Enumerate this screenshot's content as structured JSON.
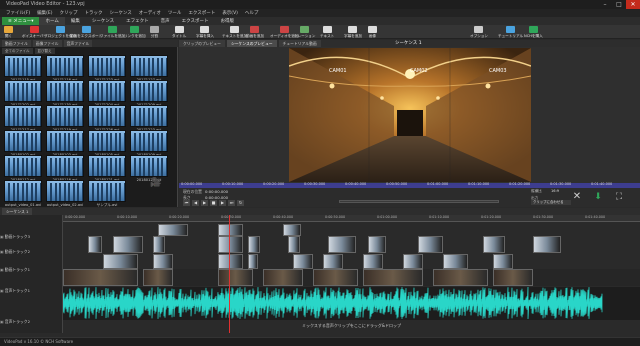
{
  "window": {
    "title": "VideoPad Video Editor - 123.vpj"
  },
  "menu": [
    "ファイル(F)",
    "編集(E)",
    "クリップ",
    "トラック",
    "シーケンス",
    "オーディオ",
    "ツール",
    "エクスポート",
    "表示(V)",
    "ヘルプ"
  ],
  "ribbon_tabs": {
    "menu_button": "≡ メニュー▾",
    "tabs": [
      "ホーム",
      "編集",
      "シーケンス",
      "エフェクト",
      "音声",
      "エクスポート",
      "お得版"
    ]
  },
  "toolbar": [
    {
      "label": "開く",
      "color": "#e8a73a"
    },
    {
      "label": "ボイスオーバー",
      "color": "#d33"
    },
    {
      "label": "プロジェクトを保存",
      "color": "#4aa3df"
    },
    {
      "label": "動画をエクスポート",
      "color": "#4aa3df"
    },
    {
      "label": "ファイルを追加",
      "color": "#2fa65a"
    },
    {
      "label": "リンクを追加",
      "color": "#2fa65a"
    },
    {
      "label": "分割",
      "color": "#aaa"
    },
    {
      "label": "タイトル",
      "color": "#ddd"
    },
    {
      "label": "字幕を挿入",
      "color": "#ddd"
    },
    {
      "label": "テキストを追加",
      "color": "#ddd"
    },
    {
      "label": "動画を追加",
      "color": "#c44"
    },
    {
      "label": "オーディオを追加",
      "color": "#c44"
    },
    {
      "label": "ナレーション",
      "color": "#6a6"
    },
    {
      "label": "テキスト",
      "color": "#ddd"
    },
    {
      "label": "字幕を追加",
      "color": "#ddd"
    },
    {
      "label": "画像",
      "color": "#ddd"
    },
    {
      "label": "オプション",
      "color": "#ccc"
    },
    {
      "label": "チュートリアル",
      "color": "#4aa3df"
    },
    {
      "label": "NCHを購入",
      "color": "#2fa65a"
    }
  ],
  "bin": {
    "tabs": [
      "動画ファイル",
      "画像ファイル",
      "音声ファイル"
    ],
    "filters": [
      "全てのファイル",
      "並び替え"
    ],
    "clips": [
      "20171115.avi",
      "20171116.avi",
      "20171123.avi",
      "20171127.avi",
      "20171202.avi",
      "20171130.avi",
      "20171204.avi",
      "20171209.avi",
      "20171217.avi",
      "20171219.avi",
      "20171226.avi",
      "20171223.avi",
      "20180102.avi",
      "20180103.avi",
      "20180105.avi",
      "20180109.avi",
      "20180112.avi",
      "20180116.avi",
      "20180121.avi",
      "20180128.avi",
      "output_video_01.avi",
      "output_video_02.avi",
      "サンプル.avi",
      ""
    ]
  },
  "preview": {
    "tabs": [
      "クリップのプレビュー",
      "シーケンスのプレビュー",
      "チュートリアル動画"
    ],
    "sequence_label": "シーケンス 1",
    "camera_labels": [
      "CAM01",
      "CAM02",
      "CAM03"
    ],
    "ruler_times": [
      "0:00:00.000",
      "0:00:10.000",
      "0:00:20.000",
      "0:00:30.000",
      "0:00:40.000",
      "0:00:50.000",
      "0:01:00.000",
      "0:01:10.000",
      "0:01:20.000",
      "0:01:30.000",
      "0:01:40.000"
    ],
    "position_label": "現在の位置",
    "position_value": "0:00:00.000",
    "duration_label": "長さ",
    "duration_value": "0:00:00.000",
    "ratio_label": "縦横比",
    "ratio_value": "16:9",
    "output_label": "出力",
    "output_value": "クリップに合わせる",
    "split_label": "分割",
    "export_label": "書出"
  },
  "timeline": {
    "tab": "シーケンス 1",
    "times": [
      "0:00:00.000",
      "0:00:10.000",
      "0:00:20.000",
      "0:00:30.000",
      "0:00:40.000",
      "0:00:50.000",
      "0:01:00.000",
      "0:01:10.000",
      "0:01:20.000",
      "0:01:30.000",
      "0:01:40.000"
    ],
    "tracks": [
      "動画トラック3",
      "動画トラック2",
      "動画トラック1",
      "音声トラック1",
      "音声トラック2"
    ],
    "drop_hint": "ここにオーディオクリップをドラッグ&ドロップ",
    "drop_hint_prefix": "ミックスする音声クリップをここにドラッグ&ドロップ"
  },
  "status": "VideoPad v 16.10 © NCH Software"
}
